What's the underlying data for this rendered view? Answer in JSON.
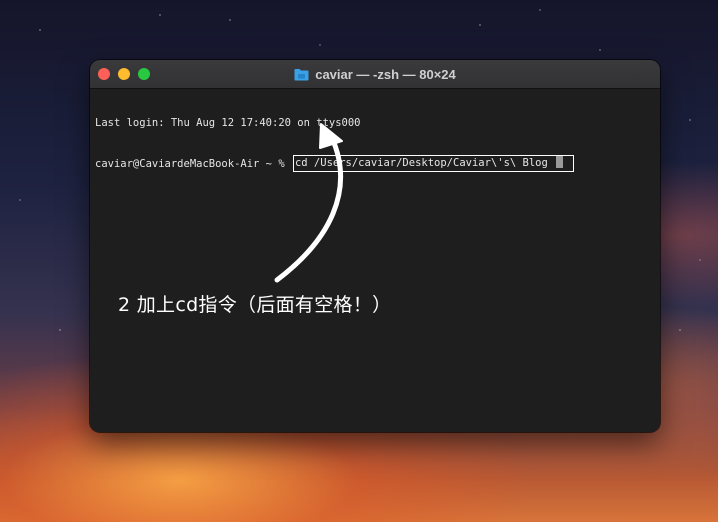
{
  "window": {
    "title": "caviar — -zsh — 80×24",
    "folder_icon": "folder-icon",
    "accent": "#3aa0e8"
  },
  "terminal": {
    "last_login": "Last login: Thu Aug 12 17:40:20 on ttys000",
    "prompt": "caviar@CaviardeMacBook-Air ~ % ",
    "command": "cd /Users/caviar/Desktop/Caviar\\'s\\ Blog "
  },
  "annotation": {
    "text": "2 加上cd指令（后面有空格！）"
  },
  "colors": {
    "close": "#fe5f57",
    "minimize": "#febc2e",
    "zoom": "#28c840",
    "terminal_bg": "#1e1e1e",
    "highlight_border": "#ffffff"
  }
}
